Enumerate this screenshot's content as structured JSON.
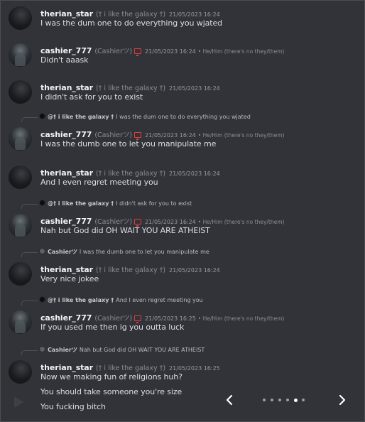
{
  "messages": [
    {
      "type": "message",
      "user": "therian_star",
      "nick": "(† i like the galaxy †)",
      "timestamp": "21/05/2023 16:24",
      "texts": [
        "I was the dum one to do everything you wjated"
      ]
    },
    {
      "type": "message",
      "user": "cashier_777",
      "nick": "(Cashierツ)",
      "timestamp": "21/05/2023 16:24",
      "pronouns": "• He/Him (there's no they/them)",
      "texts": [
        "Didn't aaask"
      ]
    },
    {
      "type": "message",
      "user": "therian_star",
      "nick": "(† i like the galaxy †)",
      "timestamp": "21/05/2023 16:24",
      "texts": [
        "I didn't ask for you to exist"
      ]
    },
    {
      "type": "message",
      "reply": {
        "name": "@† i like the galaxy †",
        "text": "I was the dum one to do everything you wjated"
      },
      "user": "cashier_777",
      "nick": "(Cashierツ)",
      "timestamp": "21/05/2023 16:24",
      "pronouns": "• He/Him (there's no they/them)",
      "texts": [
        "I was the dumb one to let you manipulate me"
      ]
    },
    {
      "type": "message",
      "user": "therian_star",
      "nick": "(† i like the galaxy †)",
      "timestamp": "21/05/2023 16:24",
      "texts": [
        "And I even regret meeting you"
      ]
    },
    {
      "type": "message",
      "reply": {
        "name": "@† i like the galaxy †",
        "text": "I didn't ask for you to exist"
      },
      "user": "cashier_777",
      "nick": "(Cashierツ)",
      "timestamp": "21/05/2023 16:24",
      "pronouns": "• He/Him (there's no they/them)",
      "texts": [
        "Nah but God did OH WAIT YOU ARE ATHEIST"
      ]
    },
    {
      "type": "message",
      "reply": {
        "name": "Cashierツ",
        "text": "I was the dumb one to let you manipulate me"
      },
      "user": "therian_star",
      "nick": "(† i like the galaxy †)",
      "timestamp": "21/05/2023 16:24",
      "texts": [
        "Very nice jokee"
      ]
    },
    {
      "type": "message",
      "reply": {
        "name": "@† i like the galaxy †",
        "text": "And I even regret meeting you"
      },
      "user": "cashier_777",
      "nick": "(Cashierツ)",
      "timestamp": "21/05/2023 16:25",
      "pronouns": "• He/Him (there's no they/them)",
      "texts": [
        "If you used me then ig you outta luck"
      ]
    },
    {
      "type": "message",
      "reply": {
        "name": "Cashierツ",
        "text": "Nah but God did OH WAIT YOU ARE ATHEIST"
      },
      "user": "therian_star",
      "nick": "(† i like the galaxy †)",
      "timestamp": "21/05/2023 16:25",
      "texts": [
        "Now we making fun of religions huh?",
        "You should take someone you're size",
        "You fucking bitch"
      ]
    }
  ],
  "carousel": {
    "prev": "‹",
    "next": "›",
    "total": 6,
    "active": 4
  },
  "colors": {
    "background": "#313338",
    "text": "#dbdee1",
    "timestamp": "#949ba4",
    "moderator_icon": "#e23c3c"
  }
}
